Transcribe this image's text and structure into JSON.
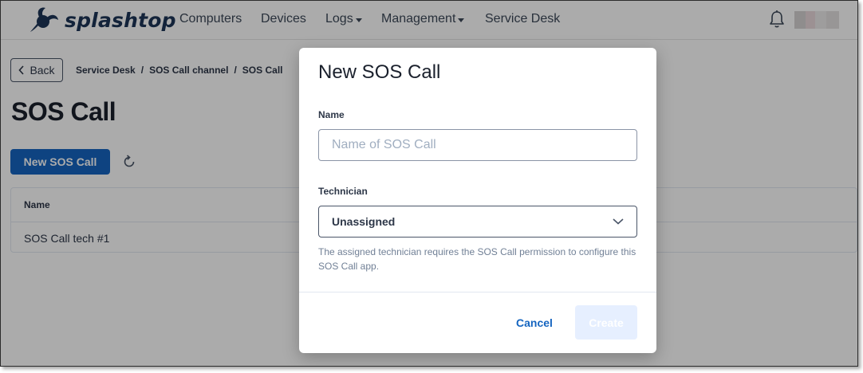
{
  "brand": {
    "name": "splashtop",
    "accent_color": "#1565c0",
    "logo_color": "#1d3557"
  },
  "nav": {
    "items": [
      {
        "label": "Computers",
        "has_dropdown": false
      },
      {
        "label": "Devices",
        "has_dropdown": false
      },
      {
        "label": "Logs",
        "has_dropdown": true
      },
      {
        "label": "Management",
        "has_dropdown": true
      },
      {
        "label": "Service Desk",
        "has_dropdown": false
      }
    ],
    "notification_icon": "bell-icon"
  },
  "page": {
    "back_label": "Back",
    "breadcrumb": [
      "Service Desk",
      "SOS Call channel",
      "SOS Call"
    ],
    "breadcrumb_separator": "/",
    "title": "SOS Call",
    "new_button_label": "New SOS Call",
    "refresh_icon": "refresh-icon",
    "table": {
      "columns": [
        "Name"
      ],
      "rows": [
        [
          "SOS Call tech #1"
        ]
      ]
    }
  },
  "modal": {
    "title": "New SOS Call",
    "name_label": "Name",
    "name_placeholder": "Name of SOS Call",
    "name_value": "",
    "technician_label": "Technician",
    "technician_selected": "Unassigned",
    "technician_hint": "The assigned technician requires the SOS Call permission to configure this SOS Call app.",
    "cancel_label": "Cancel",
    "create_label": "Create",
    "create_disabled": true
  }
}
